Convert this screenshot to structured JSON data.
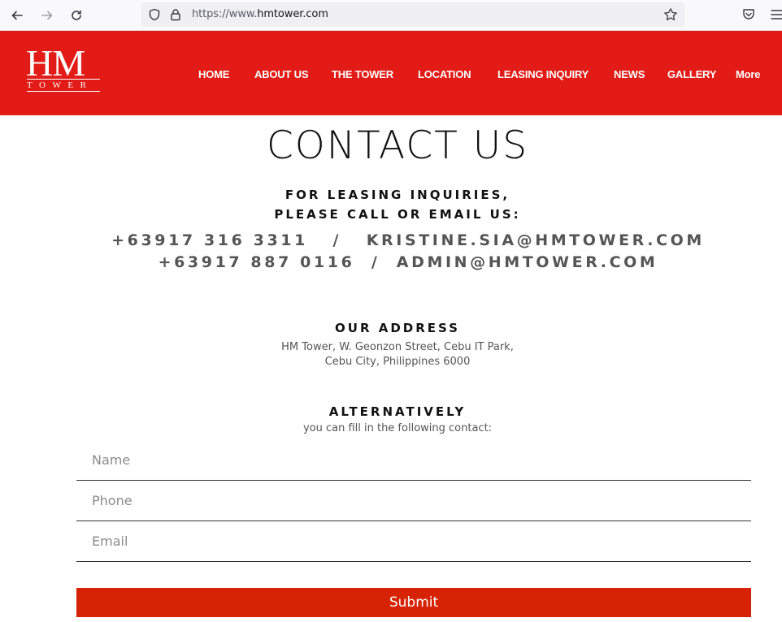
{
  "browser": {
    "url_prefix": "https://www.",
    "url_domain": "hmtower.com",
    "icons": [
      "back-arrow-icon",
      "forward-arrow-icon",
      "reload-icon",
      "shield-icon",
      "lock-icon",
      "bookmark-star-icon",
      "pocket-icon",
      "hamburger-menu-icon"
    ]
  },
  "header": {
    "logo_main": "HM",
    "logo_sub": "TOWER",
    "nav": [
      "HOME",
      "ABOUT US",
      "THE TOWER",
      "LOCATION",
      "LEASING INQUIRY",
      "NEWS",
      "GALLERY",
      "More"
    ],
    "bg_color": "#e21b16"
  },
  "content": {
    "title": "CONTACT US",
    "subhead_line1": "FOR LEASING INQUIRIES,",
    "subhead_line2": "PLEASE CALL OR EMAIL US:",
    "contact_line1": "+63917 316 3311   /   KRISTINE.SIA@HMTOWER.COM",
    "contact_line2": "+63917 887 0116  /  ADMIN@HMTOWER.COM",
    "address_heading": "OUR ADDRESS",
    "address_line1": "HM Tower, W. Geonzon Street, Cebu IT Park,",
    "address_line2": "Cebu City, Philippines 6000",
    "alt_heading": "ALTERNATIVELY",
    "alt_text": "you can fill in the following contact:"
  },
  "form": {
    "name_placeholder": "Name",
    "phone_placeholder": "Phone",
    "email_placeholder": "Email",
    "submit_label": "Submit",
    "submit_color": "#d62306"
  }
}
